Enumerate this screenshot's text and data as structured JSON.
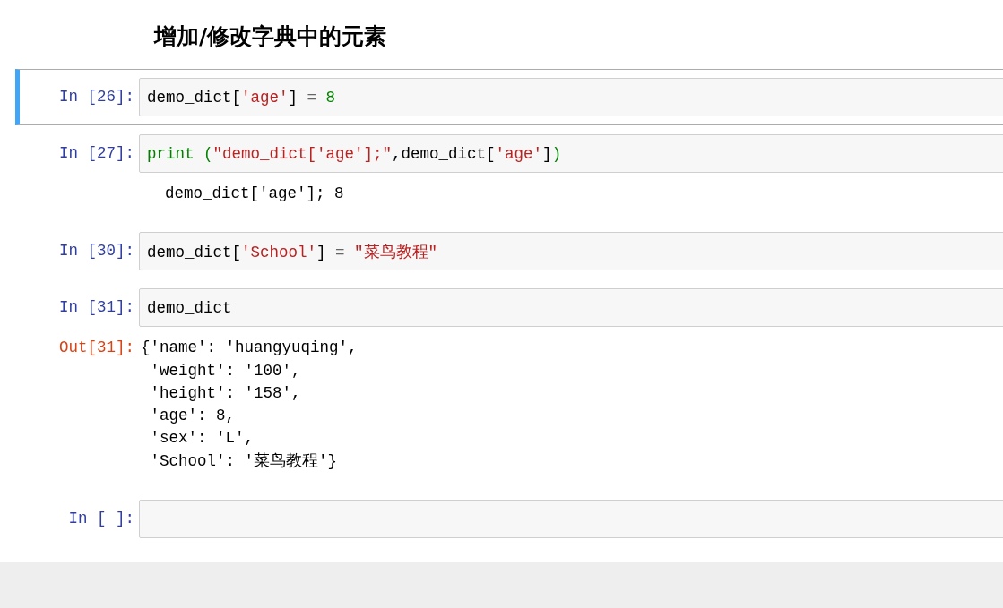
{
  "cells": [
    {
      "kind": "markdown",
      "selected": false,
      "text": "增加/修改字典中的元素"
    },
    {
      "kind": "code",
      "selected": true,
      "prompt": "In [26]:",
      "code": [
        {
          "kind": "plain",
          "t": "demo_dict["
        },
        {
          "kind": "string",
          "t": "'age'"
        },
        {
          "kind": "plain",
          "t": "]"
        },
        {
          "kind": "operator",
          "t": "="
        },
        {
          "kind": "number",
          "t": "8"
        }
      ]
    },
    {
      "kind": "code",
      "selected": false,
      "prompt": "In [27]:",
      "code": [
        {
          "kind": "builtin",
          "t": "print ("
        },
        {
          "kind": "string",
          "t": "\"demo_dict['age'];\""
        },
        {
          "kind": "plain",
          "t": ",demo_dict["
        },
        {
          "kind": "string",
          "t": "'age'"
        },
        {
          "kind": "plain",
          "t": "]"
        },
        {
          "kind": "builtin",
          "t": ")"
        }
      ],
      "output": {
        "kind": "stream",
        "text": "demo_dict['age']; 8"
      }
    },
    {
      "kind": "code",
      "selected": false,
      "prompt": "In [30]:",
      "code": [
        {
          "kind": "plain",
          "t": "demo_dict["
        },
        {
          "kind": "string",
          "t": "'School'"
        },
        {
          "kind": "plain",
          "t": "]"
        },
        {
          "kind": "operator",
          "t": "="
        },
        {
          "kind": "string",
          "t": "\"菜鸟教程\""
        }
      ]
    },
    {
      "kind": "code",
      "selected": false,
      "prompt": "In [31]:",
      "code": [
        {
          "kind": "plain",
          "t": "demo_dict"
        }
      ],
      "output": {
        "kind": "result",
        "prompt": "Out[31]:",
        "text": "{'name': 'huangyuqing',\n 'weight': '100',\n 'height': '158',\n 'age': 8,\n 'sex': 'L',\n 'School': '菜鸟教程'}"
      }
    },
    {
      "kind": "code",
      "selected": false,
      "prompt": "In [ ]:"
    }
  ]
}
